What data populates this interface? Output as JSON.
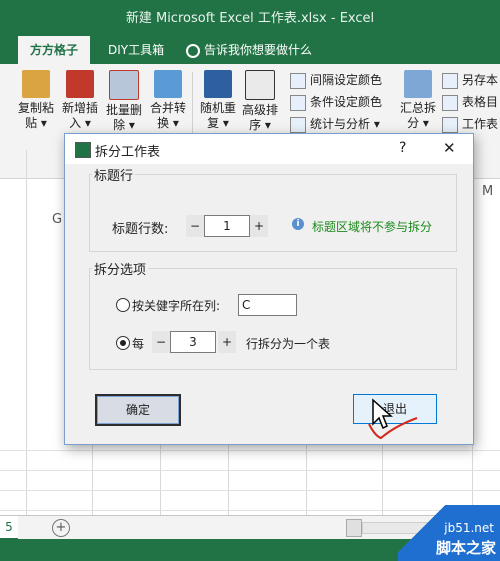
{
  "window": {
    "title": "新建 Microsoft Excel 工作表.xlsx - Excel"
  },
  "ribbon": {
    "tabs": [
      {
        "label": "方方格子",
        "active": true
      },
      {
        "label": "DIY工具箱",
        "active": false
      },
      {
        "label": "告诉我你想要做什么",
        "active": false
      }
    ],
    "buttons": [
      {
        "line1": "复制粘",
        "line2": "贴 ▾"
      },
      {
        "line1": "新增插",
        "line2": "入 ▾"
      },
      {
        "line1": "批量删",
        "line2": "除 ▾"
      },
      {
        "line1": "合并转",
        "line2": "换 ▾"
      },
      {
        "line1": "随机重",
        "line2": "复 ▾"
      },
      {
        "line1": "高级排",
        "line2": "序 ▾"
      },
      {
        "line1": "汇总拆",
        "line2": "分 ▾"
      }
    ],
    "small_buttons": [
      "间隔设定颜色",
      "条件设定颜色",
      "统计与分析 ▾",
      "另存本",
      "表格目",
      "工作表"
    ]
  },
  "grid": {
    "column_headers": [
      "G",
      "M"
    ]
  },
  "sheetbar": {
    "sheet_tab": "5",
    "add_label": "+"
  },
  "dialog": {
    "title": "拆分工作表",
    "help": "?",
    "close": "✕",
    "header_group": {
      "legend": "标题行",
      "rows_label": "标题行数:",
      "rows_value": "1",
      "minus": "−",
      "plus": "+",
      "note": "标题区域将不参与拆分"
    },
    "split_group": {
      "legend": "拆分选项",
      "by_keyword_label": "按关健字所在列:",
      "keyword_col_value": "C",
      "every_label": "每",
      "every_value": "3",
      "minus": "−",
      "plus": "+",
      "every_suffix": "行拆分为一个表"
    },
    "ok_label": "确定",
    "exit_label": "退出"
  },
  "watermark": {
    "line1": "jb51.net",
    "line2": "脚本之家"
  },
  "colors": {
    "excel_green": "#217346",
    "note_green": "#1a8a1a",
    "link_blue": "#1e5aa8"
  }
}
